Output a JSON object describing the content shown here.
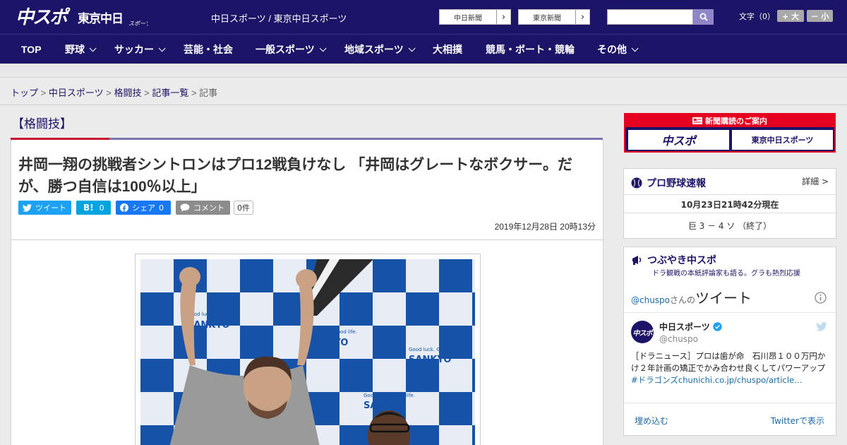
{
  "header": {
    "site_names": "中日スポーツ / 東京中日スポーツ",
    "ext_links": [
      "中日新聞",
      "東京新聞"
    ],
    "search_placeholder": "",
    "font_size_label": "文字（0）",
    "font_bigger": "+ 大",
    "font_smaller": "－ 小"
  },
  "nav": [
    {
      "label": "TOP",
      "dropdown": false
    },
    {
      "label": "野球",
      "dropdown": true
    },
    {
      "label": "サッカー",
      "dropdown": true
    },
    {
      "label": "芸能・社会",
      "dropdown": false
    },
    {
      "label": "一般スポーツ",
      "dropdown": true
    },
    {
      "label": "地域スポーツ",
      "dropdown": true
    },
    {
      "label": "大相撲",
      "dropdown": false
    },
    {
      "label": "競馬・ボート・競輪",
      "dropdown": false
    },
    {
      "label": "その他",
      "dropdown": true
    }
  ],
  "breadcrumb": {
    "links": [
      "トップ",
      "中日スポーツ",
      "格闘技",
      "記事一覧"
    ],
    "current": "記事",
    "separator": ">"
  },
  "article": {
    "category": "【格闘技】",
    "headline": "井岡一翔の挑戦者シントロンはプロ12戦負けなし 「井岡はグレートなボクサー。だが、勝つ自信は100％以上」",
    "share": {
      "tweet": "ツイート",
      "hatena_label": "B!",
      "hatena_count": "0",
      "facebook": "シェア",
      "facebook_count": "0",
      "comment": "コメント",
      "comment_count": "0件"
    },
    "date": "2019年12月28日 20時13分",
    "photo_backdrop_text": [
      "Good luck. Good life.",
      "SANKYO"
    ]
  },
  "sidebar": {
    "subscribe_banner": {
      "title": "新聞購読のご案内",
      "logos": [
        "中スポ",
        "東京中日スポーツ"
      ]
    },
    "baseball": {
      "title": "プロ野球速報",
      "detail_link": "詳細 >",
      "timestamp": "10月23日21時42分現在",
      "score": "巨 3 － 4 ソ （終了）"
    },
    "tsubuyaki": {
      "title": "つぶやき中スポ",
      "subtitle": "ドラ観戦の本紙評論家も語る。グラも熱烈応援",
      "handle_link": "@chuspo",
      "handle_suffix": "さんの",
      "tweets_label": "ツイート",
      "account_name": "中日スポーツ",
      "account_handle": "@chuspo",
      "tweet_text": "［ドラニュース］プロは歯が命　石川昂１００万円かけ２年計画の矯正でかみ合わせ良くしてパワーアップ",
      "tweet_link": "#ドラゴンズchunichi.co.jp/chuspo/article…",
      "embed": "埋め込む",
      "view_on": "Twitterで表示"
    }
  },
  "colors": {
    "brand_navy": "#1c1466",
    "brand_red": "#e5001f",
    "twitter_blue": "#1da1f2",
    "hatena_blue": "#00a4de",
    "facebook_blue": "#1877f2"
  }
}
